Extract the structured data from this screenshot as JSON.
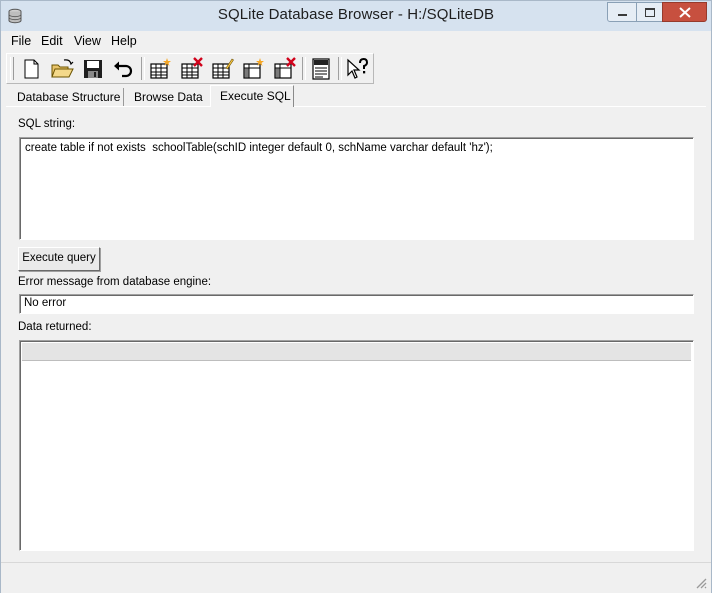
{
  "window": {
    "title": "SQLite Database Browser - H:/SQLiteDB",
    "app_icon": "database-icon",
    "controls": [
      "minimize-icon",
      "maximize-icon",
      "close-icon"
    ]
  },
  "menu": {
    "file": "File",
    "edit": "Edit",
    "view": "View",
    "help": "Help"
  },
  "toolbar": {
    "buttons": [
      {
        "name": "new-database",
        "icon": "new-file-icon"
      },
      {
        "name": "open-database",
        "icon": "open-folder-icon"
      },
      {
        "name": "write-changes",
        "icon": "save-floppy-icon"
      },
      {
        "name": "revert-changes",
        "icon": "undo-icon"
      },
      {
        "name": "create-table",
        "icon": "table-add-icon"
      },
      {
        "name": "delete-table",
        "icon": "table-delete-icon"
      },
      {
        "name": "modify-table",
        "icon": "table-edit-icon"
      },
      {
        "name": "create-index",
        "icon": "index-add-icon"
      },
      {
        "name": "delete-index",
        "icon": "index-delete-icon"
      },
      {
        "name": "sql-log",
        "icon": "log-icon"
      },
      {
        "name": "whats-this",
        "icon": "help-pointer-icon"
      }
    ]
  },
  "tabs": {
    "structure": "Database Structure",
    "browse": "Browse Data",
    "sql": "Execute SQL",
    "active": "Execute SQL"
  },
  "sql": {
    "label": "SQL string:",
    "value": "create table if not exists  schoolTable(schID integer default 0, schName varchar default 'hz');",
    "execute_label": "Execute query",
    "error_label": "Error message from database engine:",
    "error_value": "No error",
    "data_label": "Data returned:"
  },
  "colors": {
    "titlebar": "#d6e2ef",
    "close_button": "#c7503f",
    "window_bg": "#f0f0f0"
  }
}
